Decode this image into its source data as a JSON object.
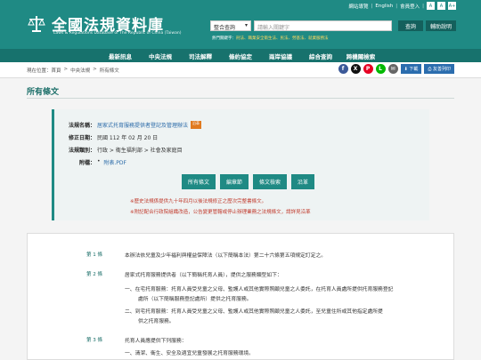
{
  "header": {
    "site_title": "全國法規資料庫",
    "site_subtitle": "Laws & Regulations Database of The Republic of China (Taiwan)",
    "top_links": [
      "網站導覽",
      "English",
      "會員登入"
    ],
    "font_sizes": [
      "A",
      "A",
      "A+"
    ],
    "search": {
      "category": "整合查詢",
      "placeholder": "請輸入關鍵字",
      "search_label": "查詢",
      "help_label": "輔助說明"
    },
    "hot_label": "熱門關鍵字：",
    "hot_keywords": "刑法、職業安全衛生法、民法、勞基法、就業服務法"
  },
  "nav": [
    "最新訊息",
    "中央法規",
    "司法解釋",
    "條約協定",
    "兩岸協議",
    "綜合查詢",
    "跨機關檢索"
  ],
  "breadcrumb": [
    "現在位置：首頁",
    ">",
    "中央法規",
    ">",
    "所有條文"
  ],
  "share": {
    "download_label": "下載",
    "print_label": "友善列印"
  },
  "page_title": "所有條文",
  "info": {
    "name_label": "法規名稱：",
    "name_value": "居家式托育服務提供者登記及管理辦法",
    "badge": "沿革",
    "amend_label": "修正日期：",
    "amend_value": "民國 112 年 02 月 20 日",
    "cat_label": "法規類別：",
    "cat_value": "行政 > 衛生福利部 > 社會及家庭目",
    "attach_label": "附檔：",
    "attach_value": "附表.PDF",
    "buttons": [
      "所有條文",
      "編章節",
      "條文檢索",
      "沿革"
    ],
    "note1": "※歷史法規係提供九十年四月以後法規修正之歷次完整書條文。",
    "note2": "※附記配合行政院組織改造，公告變更管轄或停止辦理業務之法規條文，請詳見沿革"
  },
  "articles": [
    {
      "num": "第 1 條",
      "lines": [
        "本辦法依兒童及少年福利與權益保障法（以下簡稱本法）第二十六條第五項規定訂定之。"
      ]
    },
    {
      "num": "第 2 條",
      "lines": [
        "居家式托育服務提供者（以下簡稱托育人員），提供之服務類型如下：",
        "一、在宅托育服務：托育人員受兒童之父母、監護人或其他實際照顧兒童之人委託，在托育人員處所提供托育服務登記",
        "處所（以下簡稱服務登記處所）提供之托育服務。",
        "二、到宅托育服務：托育人員受兒童之父母、監護人或其他實際照顧兒童之人委託，至兒童住所或其他指定處所提",
        "供之托育服務。"
      ]
    },
    {
      "num": "第 3 條",
      "lines": [
        "托育人員應提供下列服務：",
        "一、清潔、衛生、安全及適宜兒童發展之托育服務環境。"
      ]
    }
  ]
}
